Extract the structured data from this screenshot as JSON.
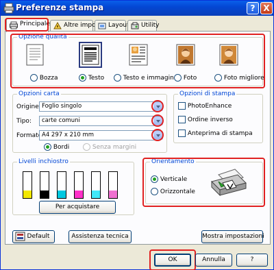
{
  "window": {
    "title": "Preferenze stampa",
    "help_label": "?",
    "close_label": "X"
  },
  "tabs": [
    {
      "label": "Principale",
      "icon": "printer-icon"
    },
    {
      "label": "Altre impost.",
      "icon": "settings-icon"
    },
    {
      "label": "Layout",
      "icon": "layout-icon"
    },
    {
      "label": "Utility",
      "icon": "utility-icon"
    }
  ],
  "quality": {
    "legend": "Opzione qualità",
    "options": [
      {
        "label": "Bozza",
        "selected": false
      },
      {
        "label": "Testo",
        "selected": true
      },
      {
        "label": "Testo e immagine",
        "selected": false
      },
      {
        "label": "Foto",
        "selected": false
      },
      {
        "label": "Foto migliore",
        "selected": false
      }
    ]
  },
  "paper": {
    "legend": "Opzioni carta",
    "source_label": "Origine:",
    "source_value": "Foglio singolo",
    "type_label": "Tipo:",
    "type_value": "carte comuni",
    "size_label": "Formato:",
    "size_value": "A4 297 x 210 mm",
    "borders_label": "Bordi",
    "borderless_label": "Senza margini"
  },
  "print_options": {
    "legend": "Opzioni di stampa",
    "items": [
      "PhotoEnhance",
      "Ordine inverso",
      "Anteprima di stampa"
    ]
  },
  "ink": {
    "legend": "Livelli inchiostro",
    "colors": [
      "#f2e800",
      "#000000",
      "#00c8e0",
      "#ff30c8",
      "#40e8f8",
      "#f070d0"
    ],
    "levels": [
      0.3,
      0.3,
      0.3,
      0.3,
      0.3,
      0.3
    ],
    "buy_label": "Per acquistare"
  },
  "orientation": {
    "legend": "Orientamento",
    "portrait_label": "Verticale",
    "landscape_label": "Orizzontale",
    "selected": "portrait"
  },
  "footer": {
    "default_label": "Default",
    "support_label": "Assistenza tecnica",
    "show_settings_label": "Mostra impostazioni"
  },
  "dialog_buttons": {
    "ok_label": "OK",
    "cancel_label": "Annulla",
    "help_label": "?"
  },
  "colors": {
    "title_bar": "#0a5fea",
    "highlight_ring": "#e02020",
    "group_legend": "#0046d5"
  }
}
